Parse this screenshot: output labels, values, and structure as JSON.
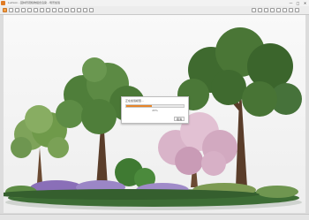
{
  "window": {
    "title": "Lumion - 园林景观植物组合渲染 - 场景加载",
    "minimize_symbol": "—",
    "maximize_symbol": "□",
    "close_symbol": "✕"
  },
  "toolbar": {
    "icons": [
      "menu-icon",
      "open-icon",
      "save-icon",
      "undo-icon",
      "redo-icon",
      "select-icon",
      "move-icon",
      "rotate-icon",
      "scale-icon",
      "brush-icon",
      "tree-icon",
      "settings-icon",
      "camera-icon",
      "render-icon",
      "help-icon"
    ]
  },
  "dialog": {
    "title": "正在加载模型...",
    "progress_percent": 45,
    "percent_text": "45%",
    "cancel_label": "取消"
  },
  "colors": {
    "accent": "#e6852a",
    "foliage_dark": "#2f5a27",
    "foliage_light": "#6f9a4a",
    "blossom": "#d9b4c9",
    "lavender": "#8a6fb8"
  }
}
